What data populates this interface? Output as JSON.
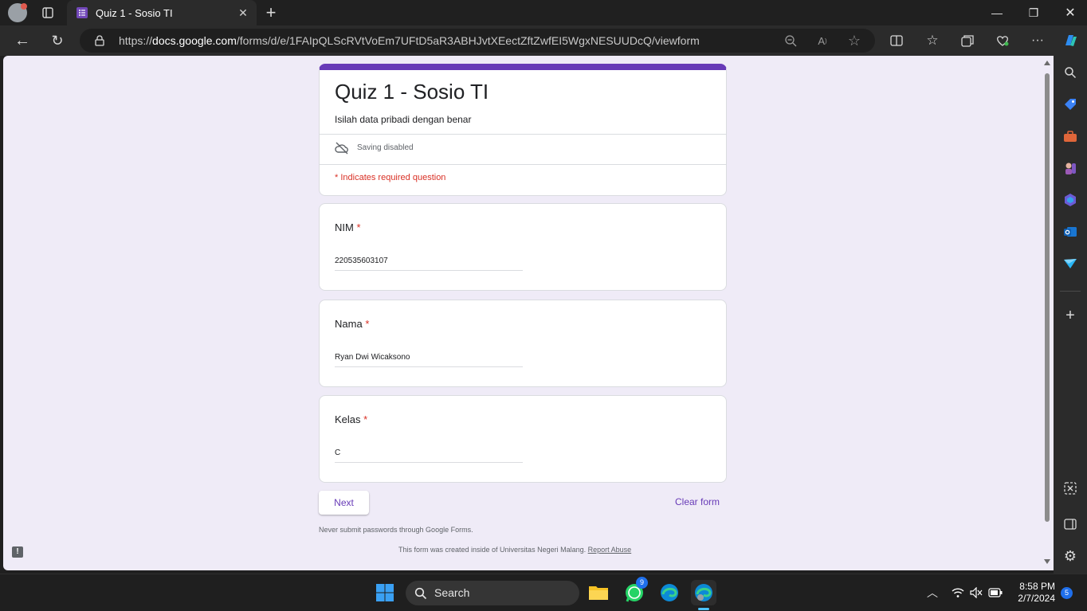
{
  "browser": {
    "tab_title": "Quiz 1 - Sosio TI",
    "url_prefix": "https://",
    "url_host": "docs.google.com",
    "url_path": "/forms/d/e/1FAIpQLScRVtVoEm7UFtD5aR3ABHJvtXEectZftZwfEI5WgxNESUUDcQ/viewform"
  },
  "form": {
    "title": "Quiz 1 - Sosio TI",
    "description": "Isilah data pribadi dengan benar",
    "saving_status": "Saving disabled",
    "required_note": "* Indicates required question",
    "questions": [
      {
        "label": "NIM",
        "required_mark": "*",
        "answer": "220535603107"
      },
      {
        "label": "Nama",
        "required_mark": "*",
        "answer": "Ryan Dwi Wicaksono"
      },
      {
        "label": "Kelas",
        "required_mark": "*",
        "answer": "C"
      }
    ],
    "next_label": "Next",
    "clear_label": "Clear form",
    "password_warning": "Never submit passwords through Google Forms.",
    "created_inside": "This form was created inside of Universitas Negeri Malang.",
    "report_abuse": "Report Abuse"
  },
  "taskbar": {
    "search_label": "Search",
    "whatsapp_badge": "9",
    "time": "8:58 PM",
    "date": "2/7/2024",
    "notification_count": "5"
  },
  "colors": {
    "accent": "#673ab7",
    "required": "#d93025",
    "page_bg": "#efebf7"
  }
}
